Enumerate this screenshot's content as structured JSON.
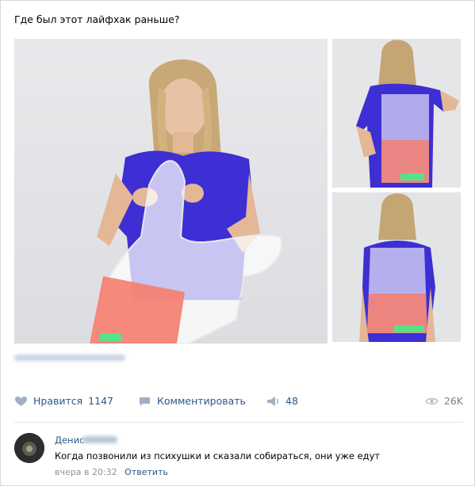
{
  "post": {
    "text": "Где был этот лайфхак раньше?"
  },
  "actions": {
    "like_label": "Нравится",
    "like_count": "1147",
    "comment_label": "Комментировать",
    "share_count": "48",
    "views_count": "26K"
  },
  "comment": {
    "author": "Денис",
    "text": "Когда позвонили из психушки и сказали собираться, они уже едут",
    "time": "вчера в 20:32",
    "reply_label": "Ответить"
  },
  "colors": {
    "link": "#2a5885",
    "muted": "#828282",
    "shirt": "#3d2fd3",
    "bag_red": "#f47f70",
    "bag_green": "#58e08a"
  },
  "icons": [
    "heart-icon",
    "comment-icon",
    "share-icon",
    "eye-icon"
  ]
}
